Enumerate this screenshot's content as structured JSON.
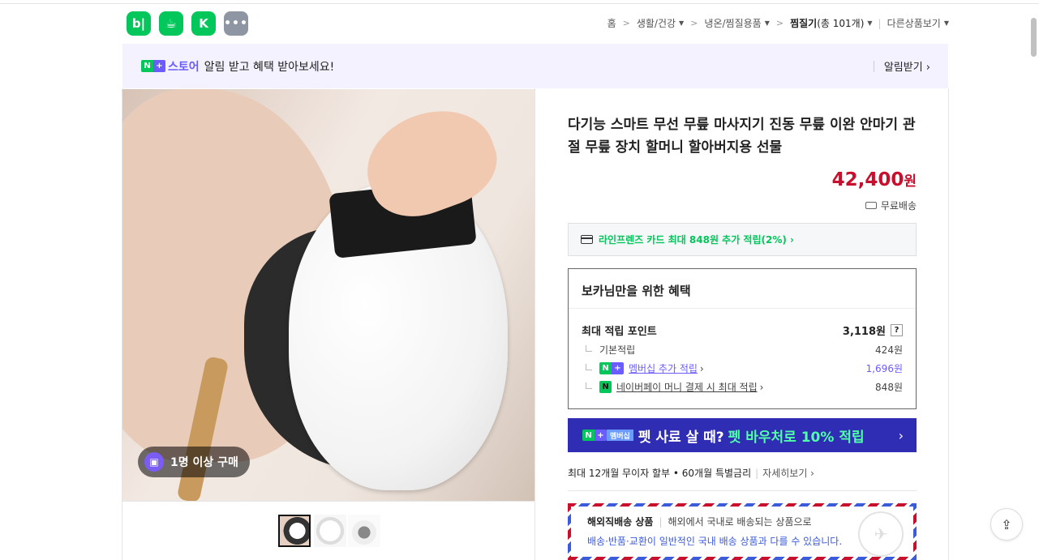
{
  "header": {
    "icons": [
      "blog-icon",
      "cafe-icon",
      "kin-icon",
      "more-icon"
    ],
    "icon_labels": {
      "blog": "b|",
      "cafe": "☕",
      "kin": "K",
      "more": "•••"
    },
    "breadcrumb": {
      "home": "홈",
      "c1": "생활/건강",
      "c2": "냉온/찜질용품",
      "c3_name": "찜질기",
      "c3_count": "(총 101개)",
      "other": "다른상품보기"
    }
  },
  "banner": {
    "store": "스토어",
    "message": "알림 받고 혜택 받아보세요!",
    "alarm": "알림받기 ›"
  },
  "gallery": {
    "buy_badge": "1명 이상 구매"
  },
  "product": {
    "title": "다기능 스마트 무선 무릎 마사지기 진동 무릎 이완 안마기 관절 무릎 장치 할머니 할아버지용 선물",
    "price": "42,400",
    "price_unit": "원",
    "shipping": "무료배송"
  },
  "card_offer": "라인프렌즈 카드 최대 848원 추가 적립(2%) ›",
  "benefits": {
    "heading": "보카님만을 위한 혜택",
    "max_label": "최대 적립 포인트",
    "max_value": "3,118원",
    "help": "?",
    "basic_label": "기본적립",
    "basic_value": "424원",
    "member_label": "멤버십 추가 적립",
    "member_value": "1,696원",
    "npay_label": "네이버페이 머니 결제 시 최대 적립",
    "npay_value": "848원"
  },
  "promo": {
    "membership": "멤버십",
    "text1": "펫 사료 살 때?",
    "text2": "펫 바우처로 10% 적립",
    "arrow": "›"
  },
  "installment": {
    "text": "최대 12개월 무이자 할부 • 60개월 특별금리",
    "more": "자세히보기 ›"
  },
  "oversea": {
    "title": "해외직배송 상품",
    "desc": "해외에서 국내로 배송되는 상품으로",
    "notice": "배송·반품·교환이 일반적인 국내 배송 상품과 다를 수 있습니다."
  },
  "colors": {
    "naver_green": "#03c75a",
    "price_red": "#c8102e",
    "store_purple": "#6b5cff",
    "promo_navy": "#2f2db3"
  }
}
